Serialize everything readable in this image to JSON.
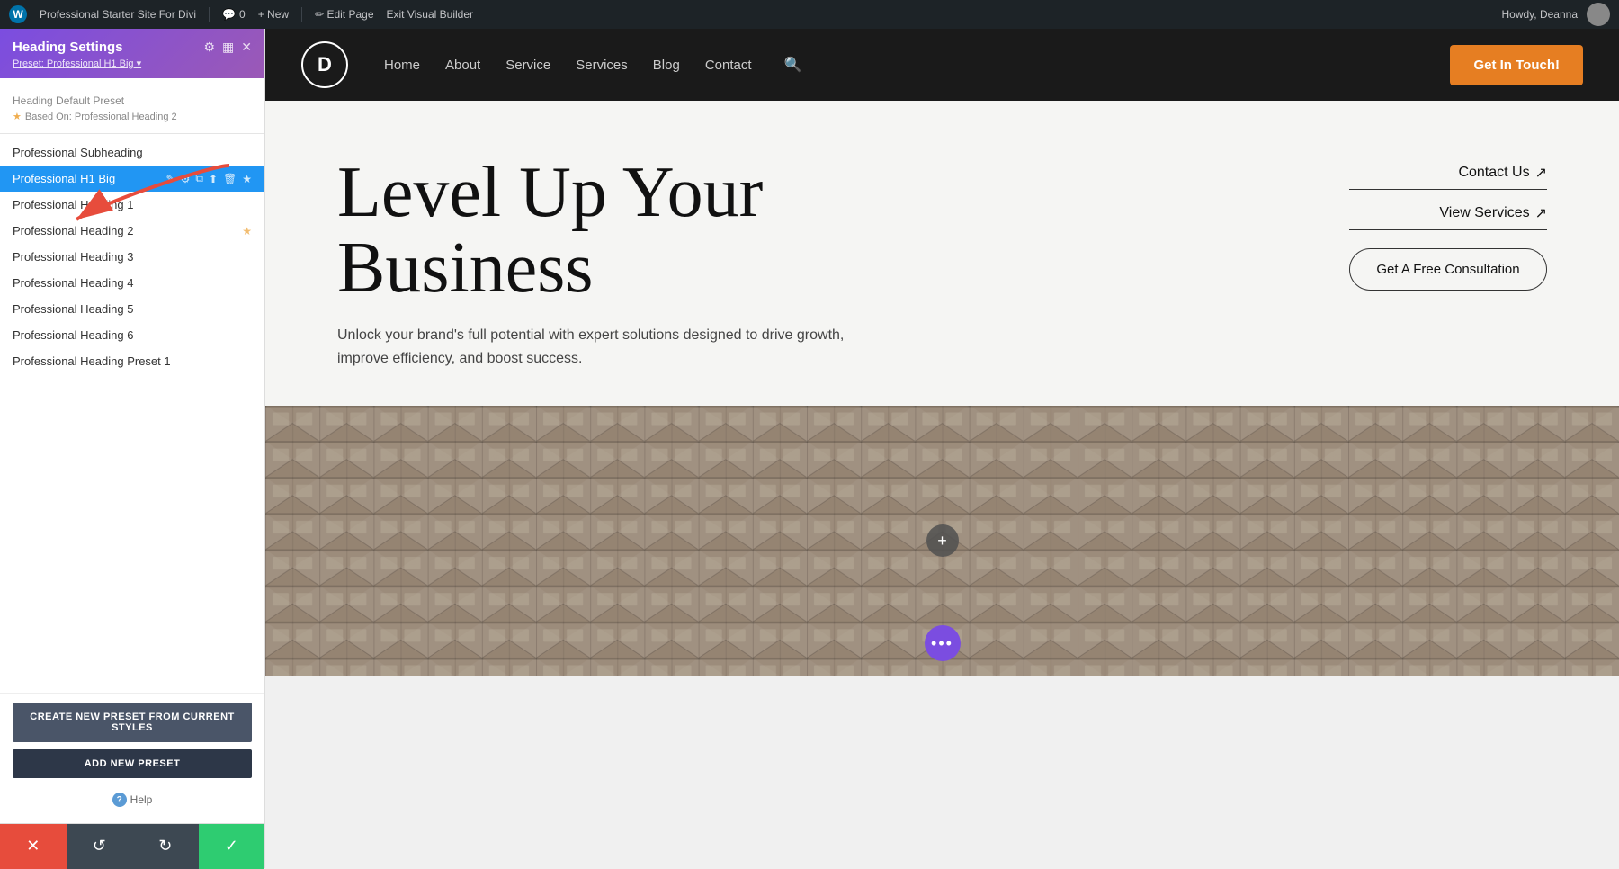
{
  "admin_bar": {
    "wp_label": "W",
    "site_name": "Professional Starter Site For Divi",
    "comments_count": "0",
    "new_label": "+ New",
    "edit_page_label": "✏ Edit Page",
    "exit_builder_label": "Exit Visual Builder",
    "howdy_label": "Howdy, Deanna",
    "separator": "|"
  },
  "panel": {
    "title": "Heading Settings",
    "preset_label": "Preset: Professional H1 Big ▾",
    "section_label": "Heading Default Preset",
    "based_on": "Based On: Professional Heading 2",
    "presets": [
      {
        "name": "Professional Subheading",
        "active": false,
        "star": false
      },
      {
        "name": "Professional H1 Big",
        "active": true,
        "star": false
      },
      {
        "name": "Professional Heading 1",
        "active": false,
        "star": false
      },
      {
        "name": "Professional Heading 2",
        "active": false,
        "star": true
      },
      {
        "name": "Professional Heading 3",
        "active": false,
        "star": false
      },
      {
        "name": "Professional Heading 4",
        "active": false,
        "star": false
      },
      {
        "name": "Professional Heading 5",
        "active": false,
        "star": false
      },
      {
        "name": "Professional Heading 6",
        "active": false,
        "star": false
      },
      {
        "name": "Professional Heading Preset 1",
        "active": false,
        "star": false
      }
    ],
    "btn_create": "CREATE NEW PRESET FROM CURRENT STYLES",
    "btn_add": "ADD NEW PRESET",
    "help_label": "Help"
  },
  "toolbar": {
    "cancel_icon": "✕",
    "undo_icon": "↺",
    "redo_icon": "↻",
    "save_icon": "✓"
  },
  "site": {
    "logo_letter": "D",
    "nav_links": [
      "Home",
      "About",
      "Service",
      "Services",
      "Blog",
      "Contact"
    ],
    "nav_cta": "Get In Touch!",
    "hero_heading_line1": "Level Up Your",
    "hero_heading_line2": "Business",
    "hero_subtext": "Unlock your brand's full potential with expert solutions designed to drive growth, improve efficiency, and boost success.",
    "hero_link1": "Contact Us",
    "hero_link2": "View Services",
    "hero_btn": "Get A Free Consultation"
  }
}
